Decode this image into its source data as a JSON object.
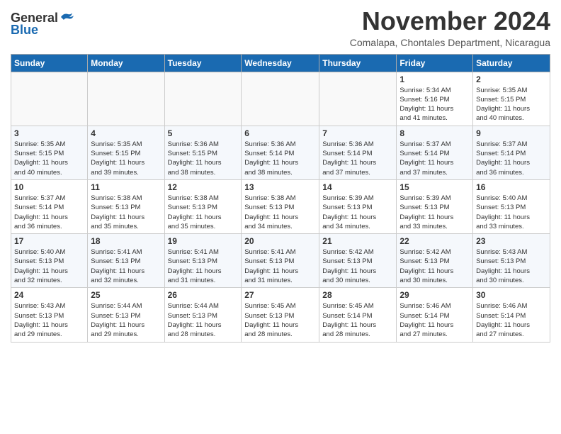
{
  "header": {
    "logo_general": "General",
    "logo_blue": "Blue",
    "month_title": "November 2024",
    "subtitle": "Comalapa, Chontales Department, Nicaragua"
  },
  "weekdays": [
    "Sunday",
    "Monday",
    "Tuesday",
    "Wednesday",
    "Thursday",
    "Friday",
    "Saturday"
  ],
  "weeks": [
    [
      {
        "day": "",
        "info": ""
      },
      {
        "day": "",
        "info": ""
      },
      {
        "day": "",
        "info": ""
      },
      {
        "day": "",
        "info": ""
      },
      {
        "day": "",
        "info": ""
      },
      {
        "day": "1",
        "info": "Sunrise: 5:34 AM\nSunset: 5:16 PM\nDaylight: 11 hours\nand 41 minutes."
      },
      {
        "day": "2",
        "info": "Sunrise: 5:35 AM\nSunset: 5:15 PM\nDaylight: 11 hours\nand 40 minutes."
      }
    ],
    [
      {
        "day": "3",
        "info": "Sunrise: 5:35 AM\nSunset: 5:15 PM\nDaylight: 11 hours\nand 40 minutes."
      },
      {
        "day": "4",
        "info": "Sunrise: 5:35 AM\nSunset: 5:15 PM\nDaylight: 11 hours\nand 39 minutes."
      },
      {
        "day": "5",
        "info": "Sunrise: 5:36 AM\nSunset: 5:15 PM\nDaylight: 11 hours\nand 38 minutes."
      },
      {
        "day": "6",
        "info": "Sunrise: 5:36 AM\nSunset: 5:14 PM\nDaylight: 11 hours\nand 38 minutes."
      },
      {
        "day": "7",
        "info": "Sunrise: 5:36 AM\nSunset: 5:14 PM\nDaylight: 11 hours\nand 37 minutes."
      },
      {
        "day": "8",
        "info": "Sunrise: 5:37 AM\nSunset: 5:14 PM\nDaylight: 11 hours\nand 37 minutes."
      },
      {
        "day": "9",
        "info": "Sunrise: 5:37 AM\nSunset: 5:14 PM\nDaylight: 11 hours\nand 36 minutes."
      }
    ],
    [
      {
        "day": "10",
        "info": "Sunrise: 5:37 AM\nSunset: 5:14 PM\nDaylight: 11 hours\nand 36 minutes."
      },
      {
        "day": "11",
        "info": "Sunrise: 5:38 AM\nSunset: 5:13 PM\nDaylight: 11 hours\nand 35 minutes."
      },
      {
        "day": "12",
        "info": "Sunrise: 5:38 AM\nSunset: 5:13 PM\nDaylight: 11 hours\nand 35 minutes."
      },
      {
        "day": "13",
        "info": "Sunrise: 5:38 AM\nSunset: 5:13 PM\nDaylight: 11 hours\nand 34 minutes."
      },
      {
        "day": "14",
        "info": "Sunrise: 5:39 AM\nSunset: 5:13 PM\nDaylight: 11 hours\nand 34 minutes."
      },
      {
        "day": "15",
        "info": "Sunrise: 5:39 AM\nSunset: 5:13 PM\nDaylight: 11 hours\nand 33 minutes."
      },
      {
        "day": "16",
        "info": "Sunrise: 5:40 AM\nSunset: 5:13 PM\nDaylight: 11 hours\nand 33 minutes."
      }
    ],
    [
      {
        "day": "17",
        "info": "Sunrise: 5:40 AM\nSunset: 5:13 PM\nDaylight: 11 hours\nand 32 minutes."
      },
      {
        "day": "18",
        "info": "Sunrise: 5:41 AM\nSunset: 5:13 PM\nDaylight: 11 hours\nand 32 minutes."
      },
      {
        "day": "19",
        "info": "Sunrise: 5:41 AM\nSunset: 5:13 PM\nDaylight: 11 hours\nand 31 minutes."
      },
      {
        "day": "20",
        "info": "Sunrise: 5:41 AM\nSunset: 5:13 PM\nDaylight: 11 hours\nand 31 minutes."
      },
      {
        "day": "21",
        "info": "Sunrise: 5:42 AM\nSunset: 5:13 PM\nDaylight: 11 hours\nand 30 minutes."
      },
      {
        "day": "22",
        "info": "Sunrise: 5:42 AM\nSunset: 5:13 PM\nDaylight: 11 hours\nand 30 minutes."
      },
      {
        "day": "23",
        "info": "Sunrise: 5:43 AM\nSunset: 5:13 PM\nDaylight: 11 hours\nand 30 minutes."
      }
    ],
    [
      {
        "day": "24",
        "info": "Sunrise: 5:43 AM\nSunset: 5:13 PM\nDaylight: 11 hours\nand 29 minutes."
      },
      {
        "day": "25",
        "info": "Sunrise: 5:44 AM\nSunset: 5:13 PM\nDaylight: 11 hours\nand 29 minutes."
      },
      {
        "day": "26",
        "info": "Sunrise: 5:44 AM\nSunset: 5:13 PM\nDaylight: 11 hours\nand 28 minutes."
      },
      {
        "day": "27",
        "info": "Sunrise: 5:45 AM\nSunset: 5:13 PM\nDaylight: 11 hours\nand 28 minutes."
      },
      {
        "day": "28",
        "info": "Sunrise: 5:45 AM\nSunset: 5:14 PM\nDaylight: 11 hours\nand 28 minutes."
      },
      {
        "day": "29",
        "info": "Sunrise: 5:46 AM\nSunset: 5:14 PM\nDaylight: 11 hours\nand 27 minutes."
      },
      {
        "day": "30",
        "info": "Sunrise: 5:46 AM\nSunset: 5:14 PM\nDaylight: 11 hours\nand 27 minutes."
      }
    ]
  ]
}
